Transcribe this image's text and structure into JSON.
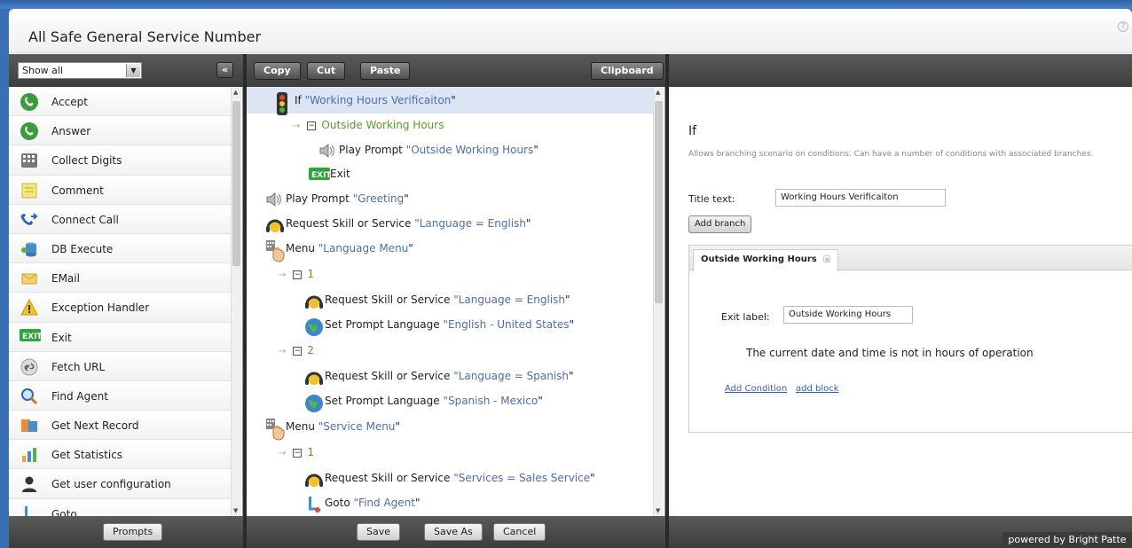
{
  "window": {
    "title": "All Safe General Service Number",
    "powered_by": "powered by Bright Patte"
  },
  "left": {
    "filter_value": "Show all",
    "collapse_label": "«",
    "components": [
      {
        "label": "Accept",
        "icon": "phone-green-icon"
      },
      {
        "label": "Answer",
        "icon": "phone-green-icon"
      },
      {
        "label": "Collect Digits",
        "icon": "keypad-icon"
      },
      {
        "label": "Comment",
        "icon": "note-icon"
      },
      {
        "label": "Connect Call",
        "icon": "connect-call-icon"
      },
      {
        "label": "DB Execute",
        "icon": "database-icon"
      },
      {
        "label": "EMail",
        "icon": "envelope-icon"
      },
      {
        "label": "Exception Handler",
        "icon": "warning-icon"
      },
      {
        "label": "Exit",
        "icon": "exit-icon"
      },
      {
        "label": "Fetch URL",
        "icon": "link-icon"
      },
      {
        "label": "Find Agent",
        "icon": "magnifier-icon"
      },
      {
        "label": "Get Next Record",
        "icon": "records-icon"
      },
      {
        "label": "Get Statistics",
        "icon": "statistics-icon"
      },
      {
        "label": "Get user configuration",
        "icon": "user-icon"
      },
      {
        "label": "Goto",
        "icon": "goto-icon"
      }
    ],
    "prompts_button": "Prompts"
  },
  "middle": {
    "toolbar": {
      "copy": "Copy",
      "cut": "Cut",
      "paste": "Paste",
      "clipboard": "Clipboard"
    },
    "tree": [
      {
        "prefix": "If ",
        "quoted": "Working Hours Verificaiton",
        "icon": "traffic-light-icon"
      },
      {
        "branch": "Outside Working Hours"
      },
      {
        "prefix": "Play Prompt ",
        "quoted": "Outside Working Hours",
        "icon": "speaker-icon"
      },
      {
        "prefix": "Exit",
        "icon": "exit-icon"
      },
      {
        "prefix": "Play Prompt ",
        "quoted": "Greeting",
        "icon": "speaker-icon"
      },
      {
        "prefix": "Request Skill or Service ",
        "quoted": "Language = English",
        "icon": "headset-icon"
      },
      {
        "prefix": "Menu ",
        "quoted": "Language Menu",
        "icon": "menu-hand-icon"
      },
      {
        "branch": "1"
      },
      {
        "prefix": "Request Skill or Service ",
        "quoted": "Language = English",
        "icon": "headset-icon"
      },
      {
        "prefix": "Set Prompt Language ",
        "quoted": "English - United States",
        "icon": "globe-icon"
      },
      {
        "branch": "2"
      },
      {
        "prefix": "Request Skill or Service ",
        "quoted": "Language = Spanish",
        "icon": "headset-icon"
      },
      {
        "prefix": "Set Prompt Language ",
        "quoted": "Spanish - Mexico",
        "icon": "globe-icon"
      },
      {
        "prefix": "Menu ",
        "quoted": "Service Menu",
        "icon": "menu-hand-icon"
      },
      {
        "branch": "1"
      },
      {
        "prefix": "Request Skill or Service ",
        "quoted": "Services = Sales Service",
        "icon": "headset-icon"
      },
      {
        "prefix": "Goto ",
        "quoted": "Find Agent",
        "icon": "goto-icon"
      }
    ],
    "save": "Save",
    "save_as": "Save As",
    "cancel": "Cancel"
  },
  "right": {
    "heading": "If",
    "description": "Allows branching scenario on conditions. Can have a number of conditions with associated branches.",
    "title_label": "Title text:",
    "title_value": "Working Hours Verificaiton",
    "add_branch": "Add branch",
    "tab_label": "Outside Working Hours",
    "tab_close": "×",
    "exit_label": "Exit label:",
    "exit_value": "Outside Working Hours",
    "condition_text": "The current date and time is not in hours of operation",
    "add_condition": "Add Condition",
    "add_block": "add block"
  }
}
